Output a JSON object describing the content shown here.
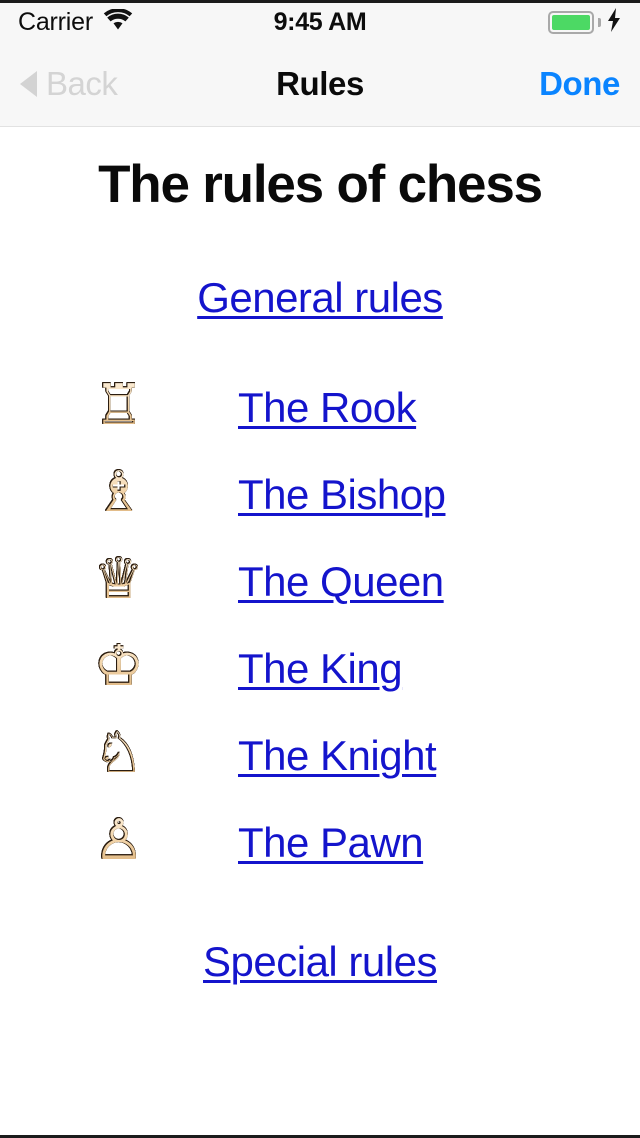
{
  "status_bar": {
    "carrier": "Carrier",
    "wifi_icon": "wifi-icon",
    "time": "9:45 AM",
    "battery_icon": "battery-full-icon",
    "charging_icon": "lightning-bolt-icon"
  },
  "nav_bar": {
    "back_label": "Back",
    "back_icon": "chevron-left-triangle-icon",
    "title": "Rules",
    "done_label": "Done",
    "done_color": "#0a84ff",
    "back_disabled_color": "#d4d4d4"
  },
  "content": {
    "heading": "The rules of chess",
    "link_color": "#1414cc",
    "general_rules_link": "General rules",
    "special_rules_link": "Special rules",
    "pieces": [
      {
        "label": "The Rook",
        "icon": "chess-rook-white-icon",
        "glyph": "♖"
      },
      {
        "label": "The Bishop",
        "icon": "chess-bishop-white-icon",
        "glyph": "♗"
      },
      {
        "label": "The Queen",
        "icon": "chess-queen-white-icon",
        "glyph": "♕"
      },
      {
        "label": "The King",
        "icon": "chess-king-white-icon",
        "glyph": "♔"
      },
      {
        "label": "The Knight",
        "icon": "chess-knight-white-icon",
        "glyph": "♘"
      },
      {
        "label": "The Pawn",
        "icon": "chess-pawn-white-icon",
        "glyph": "♙"
      }
    ]
  }
}
